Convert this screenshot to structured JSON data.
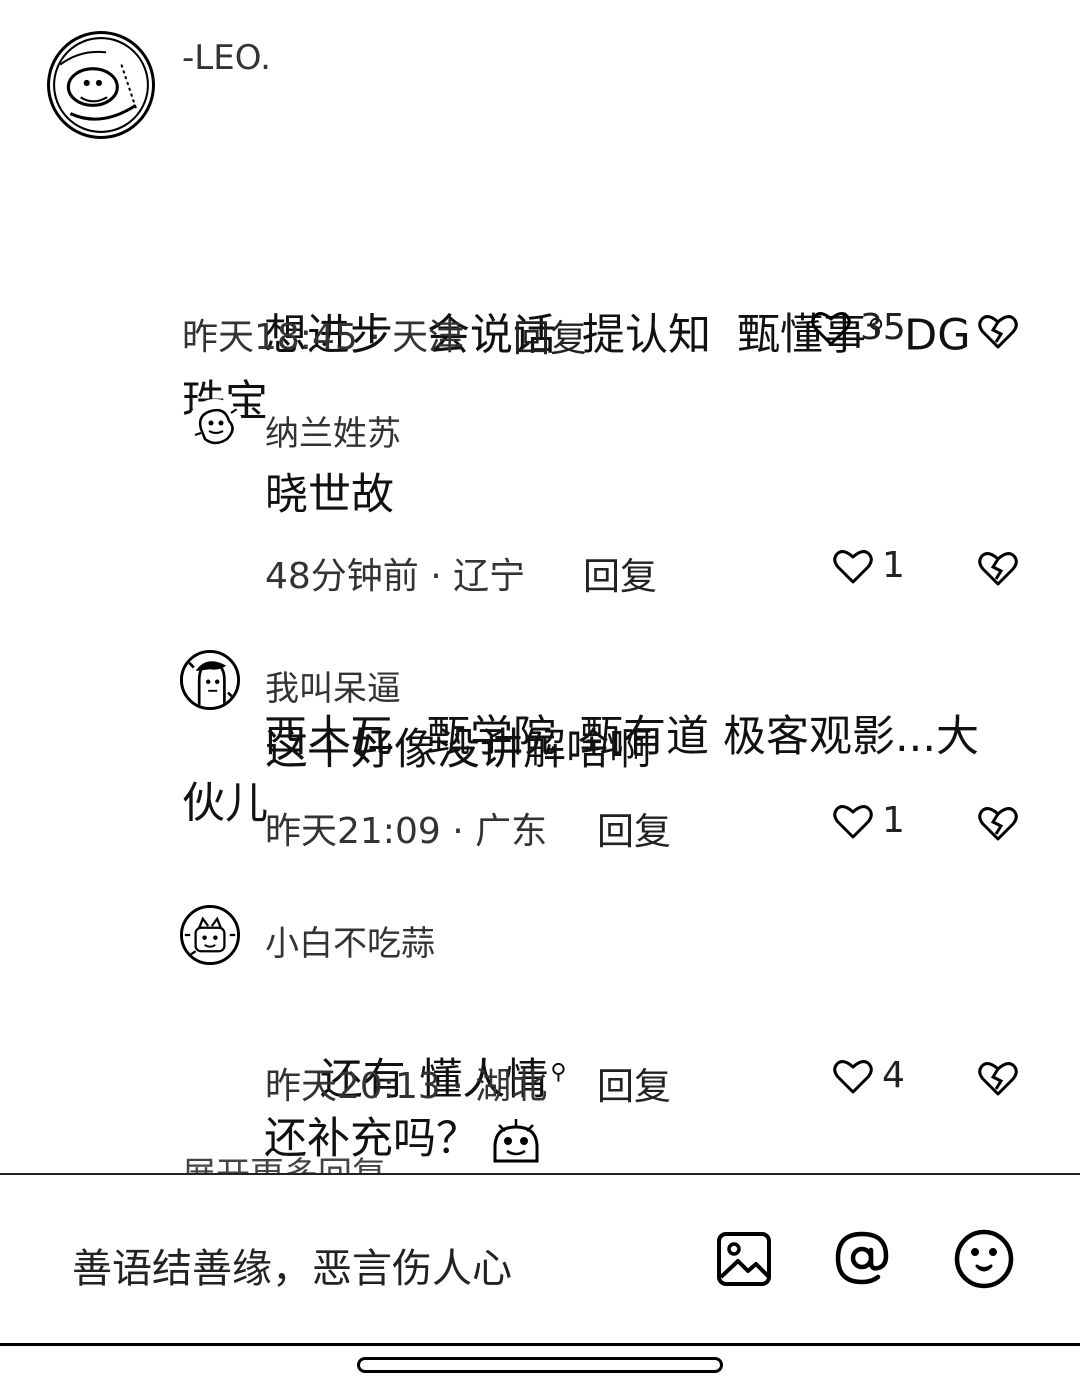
{
  "comments": [
    {
      "username": "-LEO.",
      "lines": [
        "想进步",
        "会说话",
        "提认知",
        "甄懂事",
        "DG珠宝",
        "西土瓦",
        "甄学院",
        "甄有道",
        "极客观影...大伙儿",
        "还补充吗？"
      ],
      "meta": "昨天18:45 · 天津",
      "reply_label": "回复",
      "likes": "35"
    },
    {
      "username": "纳兰姓苏",
      "text": "晓世故",
      "meta": "48分钟前 · 辽宁",
      "reply_label": "回复",
      "likes": "1"
    },
    {
      "username": "我叫呆逼",
      "text": "这个好像没讲解啥啊",
      "meta": "昨天21:09 · 广东",
      "reply_label": "回复",
      "likes": "1"
    },
    {
      "username": "小白不吃蒜",
      "text": "还有 懂人情",
      "meta": "昨天20:13 · 湖北",
      "reply_label": "回复",
      "likes": "4"
    }
  ],
  "more_replies": "展开更多回复",
  "input": {
    "placeholder": "善语结善缘，恶言伤人心"
  },
  "icons": {
    "like": "heart-outline-icon",
    "dislike": "broken-heart-icon",
    "search": "search-icon",
    "image": "image-icon",
    "mention": "at-icon",
    "emoji": "smiley-icon"
  }
}
